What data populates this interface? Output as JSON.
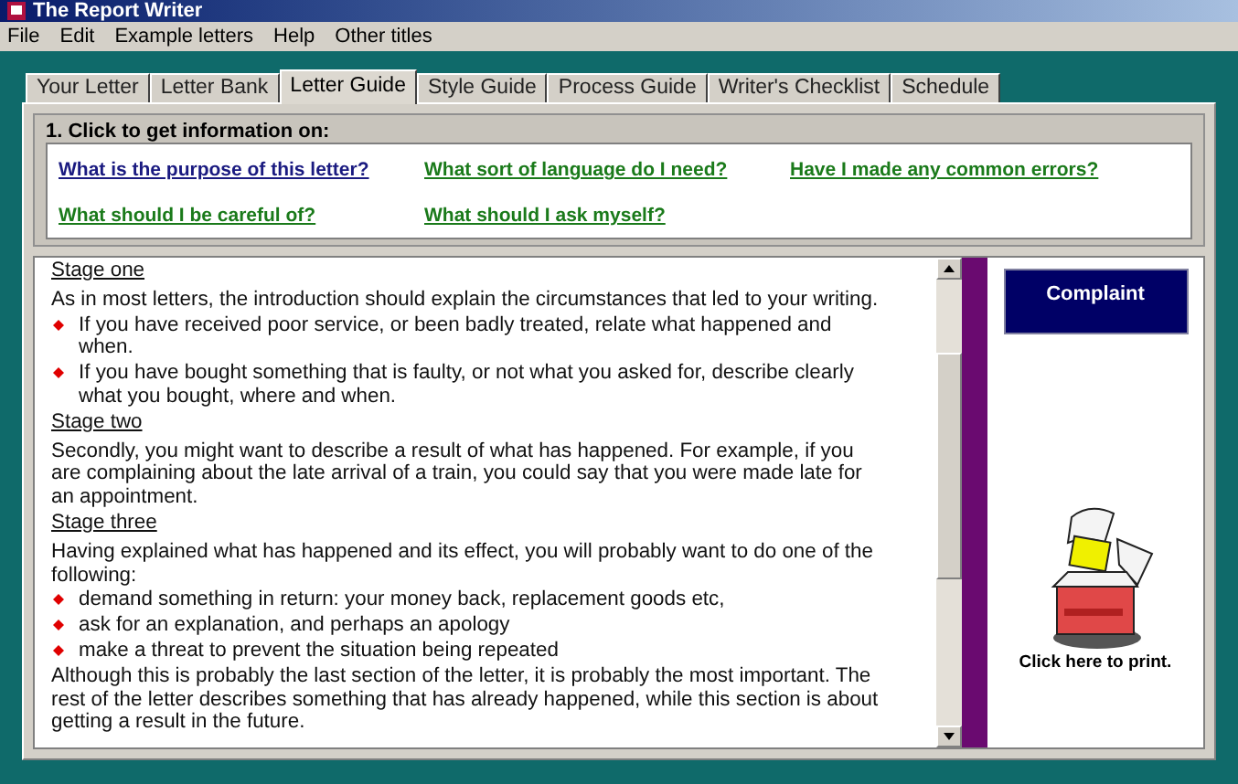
{
  "window": {
    "title": "The Report Writer"
  },
  "menu": [
    "File",
    "Edit",
    "Example letters",
    "Help",
    "Other titles"
  ],
  "tabs": [
    {
      "label": "Your Letter",
      "selected": false
    },
    {
      "label": "Letter Bank",
      "selected": false
    },
    {
      "label": "Letter Guide",
      "selected": true
    },
    {
      "label": "Style Guide",
      "selected": false
    },
    {
      "label": "Process Guide",
      "selected": false
    },
    {
      "label": "Writer's Checklist",
      "selected": false
    },
    {
      "label": "Schedule",
      "selected": false
    }
  ],
  "info": {
    "heading": "1. Click to get information on:",
    "links": [
      {
        "label": "What is the purpose of this letter?",
        "color": "#1a1a80"
      },
      {
        "label": "What sort of language do I need?",
        "color": "#1a7a1a"
      },
      {
        "label": "Have I made any common errors?",
        "color": "#1a7a1a"
      },
      {
        "label": "What should I be careful of?",
        "color": "#1a7a1a"
      },
      {
        "label": "What should I ask myself?",
        "color": "#1a7a1a"
      }
    ]
  },
  "content": [
    {
      "kind": "heading",
      "text": "Stage one"
    },
    {
      "kind": "para",
      "text": "As in most letters, the introduction should explain the circumstances that led to your writing."
    },
    {
      "kind": "bullet",
      "text": "If you have received poor service, or been badly treated, relate what happened and when."
    },
    {
      "kind": "bullet",
      "text": "If you have bought something that is faulty, or not what you asked for, describe clearly what you bought, where and when."
    },
    {
      "kind": "heading",
      "text": "Stage two"
    },
    {
      "kind": "para",
      "text": "Secondly, you might want to describe a result of what has happened. For example, if you are complaining about the late arrival of a train, you could say that you were made late for an appointment."
    },
    {
      "kind": "heading",
      "text": "Stage three"
    },
    {
      "kind": "para",
      "text": "Having explained what has happened and its effect, you will probably want to do one of the following:"
    },
    {
      "kind": "bullet",
      "text": "demand something in return: your money back, replacement goods etc,"
    },
    {
      "kind": "bullet",
      "text": "ask for an explanation, and perhaps an apology"
    },
    {
      "kind": "bullet",
      "text": "make a threat to prevent the situation being repeated"
    },
    {
      "kind": "para",
      "text": "Although this is probably the last section of the letter, it is probably the most important. The rest of the letter describes something that has already happened, while this section is about getting a result in the future."
    }
  ],
  "side": {
    "title": "Complaint",
    "print_label": "Click here to print."
  }
}
